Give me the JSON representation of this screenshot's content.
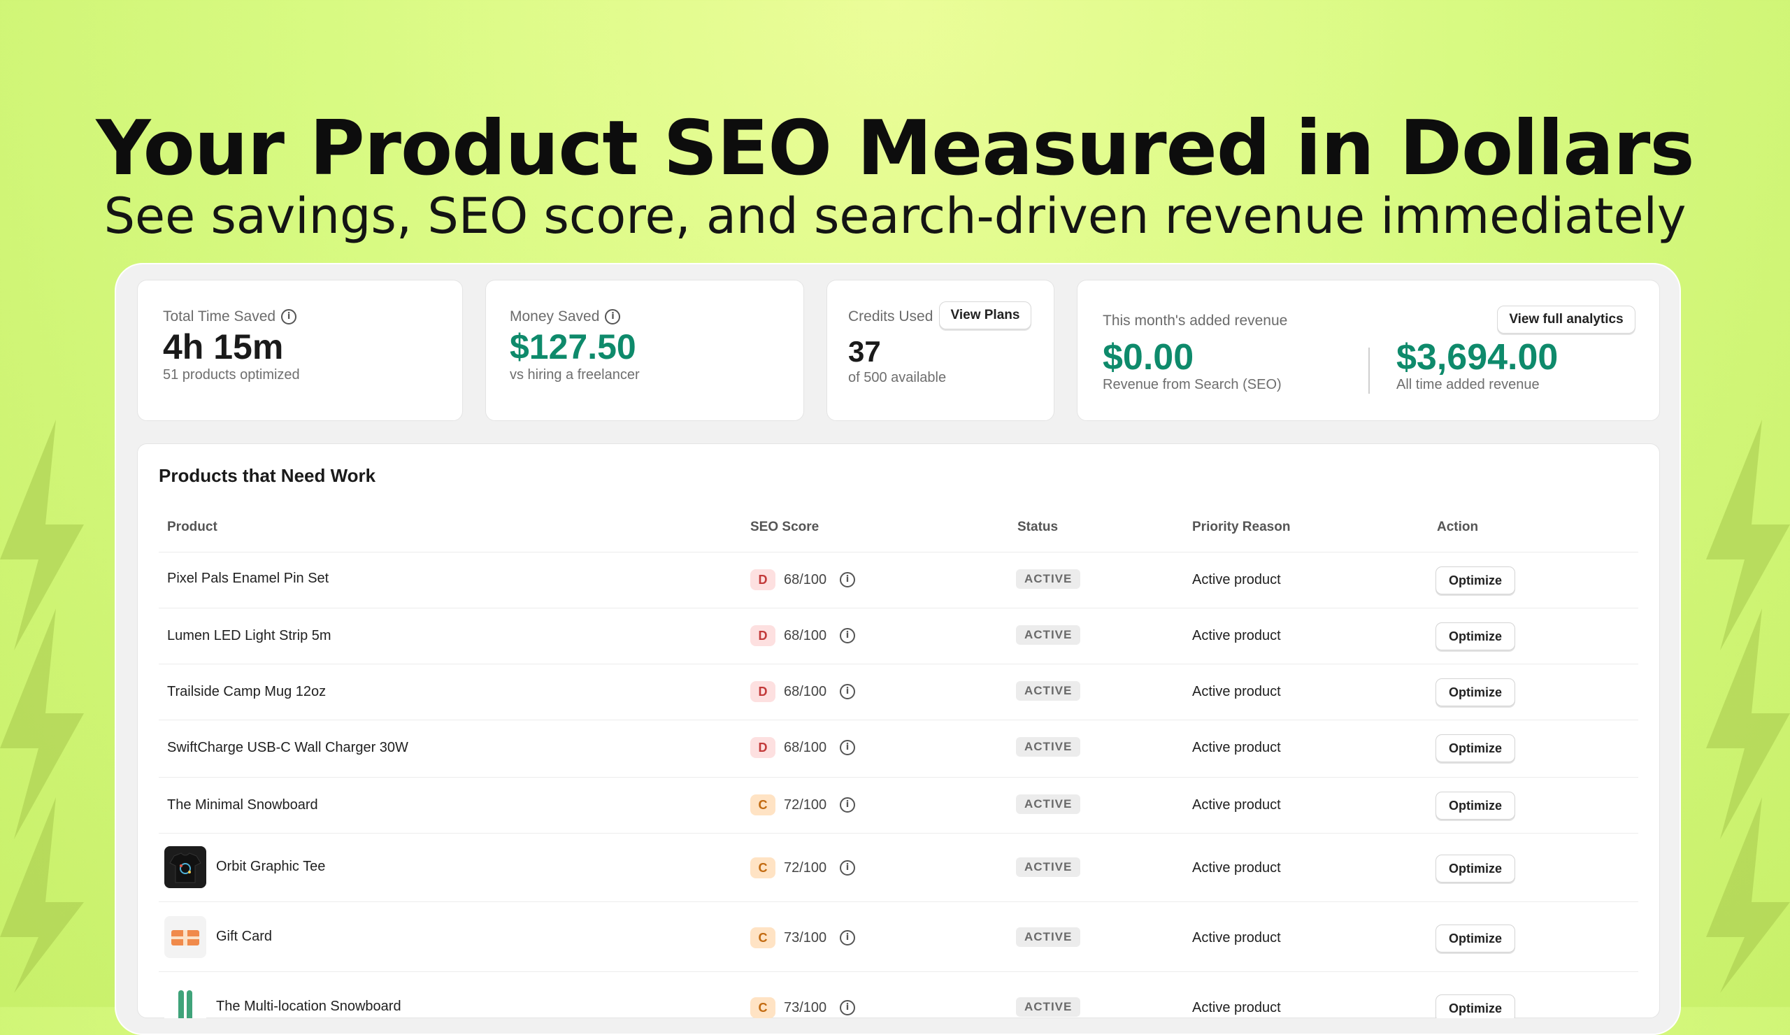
{
  "hero": {
    "title": "Your Product SEO Measured in Dollars",
    "subtitle": "See savings, SEO score, and search-driven revenue immediately"
  },
  "stats": {
    "time_saved": {
      "label": "Total Time Saved",
      "value": "4h 15m",
      "sub": "51 products optimized"
    },
    "money_saved": {
      "label": "Money Saved",
      "value": "$127.50",
      "sub": "vs hiring a freelancer"
    },
    "credits": {
      "label": "Credits Used",
      "button": "View Plans",
      "value": "37",
      "sub": "of 500 available"
    },
    "revenue": {
      "label": "This month's added revenue",
      "button": "View full analytics",
      "month_value": "$0.00",
      "month_sub": "Revenue from Search (SEO)",
      "all_value": "$3,694.00",
      "all_sub": "All time added revenue"
    }
  },
  "table": {
    "title": "Products that Need Work",
    "headers": {
      "product": "Product",
      "score": "SEO Score",
      "status": "Status",
      "reason": "Priority Reason",
      "action": "Action"
    },
    "rows": [
      {
        "product": "Pixel Pals Enamel Pin Set",
        "grade": "D",
        "score": "68/100",
        "status": "ACTIVE",
        "reason": "Active product",
        "action": "Optimize"
      },
      {
        "product": "Lumen LED Light Strip 5m",
        "grade": "D",
        "score": "68/100",
        "status": "ACTIVE",
        "reason": "Active product",
        "action": "Optimize"
      },
      {
        "product": "Trailside Camp Mug 12oz",
        "grade": "D",
        "score": "68/100",
        "status": "ACTIVE",
        "reason": "Active product",
        "action": "Optimize"
      },
      {
        "product": "SwiftCharge USB-C Wall Charger 30W",
        "grade": "D",
        "score": "68/100",
        "status": "ACTIVE",
        "reason": "Active product",
        "action": "Optimize"
      },
      {
        "product": "The Minimal Snowboard",
        "grade": "C",
        "score": "72/100",
        "status": "ACTIVE",
        "reason": "Active product",
        "action": "Optimize"
      },
      {
        "product": "Orbit Graphic Tee",
        "grade": "C",
        "score": "72/100",
        "status": "ACTIVE",
        "reason": "Active product",
        "action": "Optimize"
      },
      {
        "product": "Gift Card",
        "grade": "C",
        "score": "73/100",
        "status": "ACTIVE",
        "reason": "Active product",
        "action": "Optimize"
      },
      {
        "product": "The Multi-location Snowboard",
        "grade": "C",
        "score": "73/100",
        "status": "ACTIVE",
        "reason": "Active product",
        "action": "Optimize"
      }
    ]
  },
  "colors": {
    "accent_green": "#0e8a6b",
    "background": "#d8fa82",
    "grade_d": "#c23a3a",
    "grade_c": "#c26a10"
  }
}
